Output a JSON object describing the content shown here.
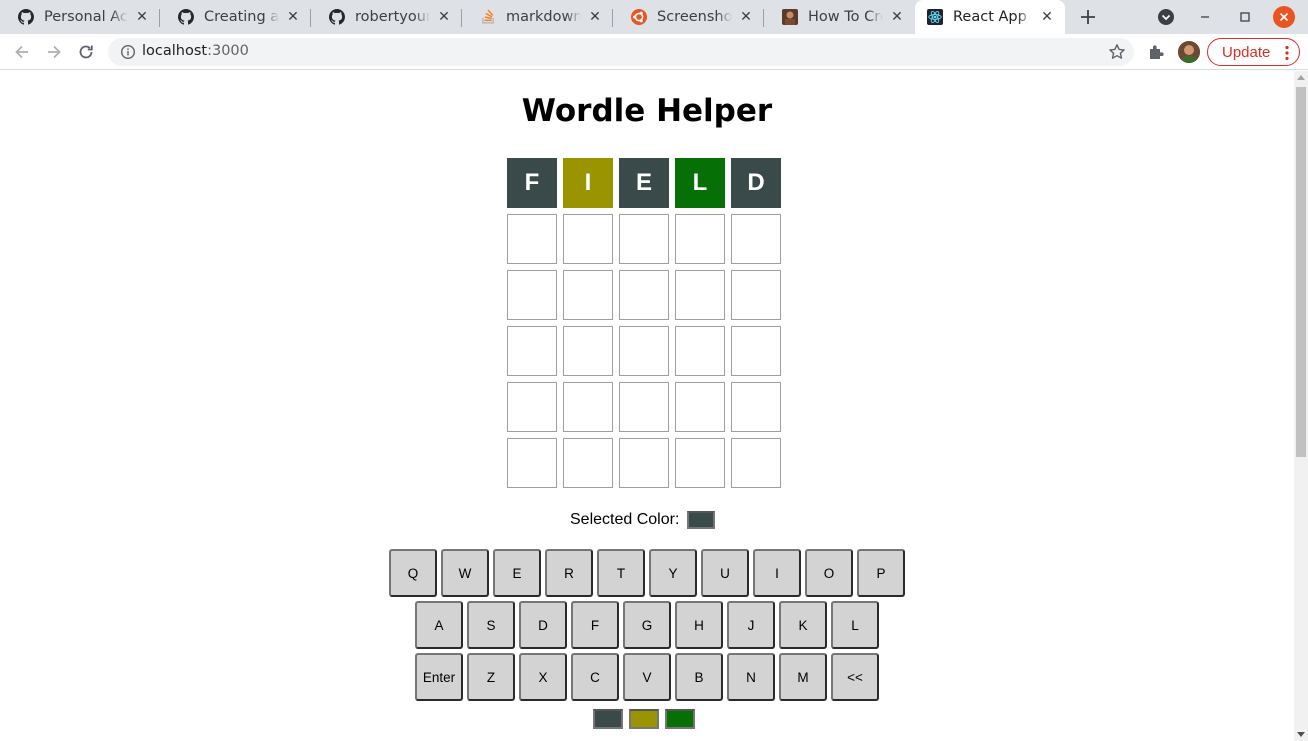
{
  "browser": {
    "tabs": [
      {
        "title": "Personal Access",
        "icon": "github-icon",
        "active": false
      },
      {
        "title": "Creating a person",
        "icon": "github-icon",
        "active": false
      },
      {
        "title": "robertyoung",
        "icon": "github-icon",
        "active": false
      },
      {
        "title": "markdown - How",
        "icon": "stackoverflow-icon",
        "active": false
      },
      {
        "title": "Screenshots",
        "icon": "ubuntu-icon",
        "active": false
      },
      {
        "title": "How To Create",
        "icon": "thumbnail-icon",
        "active": false
      },
      {
        "title": "React App",
        "icon": "react-icon",
        "active": true
      }
    ],
    "url_host": "localhost",
    "url_port": ":3000",
    "update_label": "Update",
    "colors": {
      "update": "#d93025",
      "close_window": "#e95420"
    }
  },
  "app": {
    "title": "Wordle Helper",
    "board": [
      [
        {
          "letter": "F",
          "color": "#3a4a4a"
        },
        {
          "letter": "I",
          "color": "#9a9400"
        },
        {
          "letter": "E",
          "color": "#3a4a4a"
        },
        {
          "letter": "L",
          "color": "#067006"
        },
        {
          "letter": "D",
          "color": "#3a4a4a"
        }
      ],
      [
        {
          "letter": ""
        },
        {
          "letter": ""
        },
        {
          "letter": ""
        },
        {
          "letter": ""
        },
        {
          "letter": ""
        }
      ],
      [
        {
          "letter": ""
        },
        {
          "letter": ""
        },
        {
          "letter": ""
        },
        {
          "letter": ""
        },
        {
          "letter": ""
        }
      ],
      [
        {
          "letter": ""
        },
        {
          "letter": ""
        },
        {
          "letter": ""
        },
        {
          "letter": ""
        },
        {
          "letter": ""
        }
      ],
      [
        {
          "letter": ""
        },
        {
          "letter": ""
        },
        {
          "letter": ""
        },
        {
          "letter": ""
        },
        {
          "letter": ""
        }
      ],
      [
        {
          "letter": ""
        },
        {
          "letter": ""
        },
        {
          "letter": ""
        },
        {
          "letter": ""
        },
        {
          "letter": ""
        }
      ]
    ],
    "selected_color_label": "Selected Color:",
    "selected_color": "#3a4a4a",
    "keyboard": [
      [
        "Q",
        "W",
        "E",
        "R",
        "T",
        "Y",
        "U",
        "I",
        "O",
        "P"
      ],
      [
        "A",
        "S",
        "D",
        "F",
        "G",
        "H",
        "J",
        "K",
        "L"
      ],
      [
        "Enter",
        "Z",
        "X",
        "C",
        "V",
        "B",
        "N",
        "M",
        "<<"
      ]
    ],
    "palette": [
      {
        "name": "gray",
        "color": "#3a4a4a"
      },
      {
        "name": "yellow",
        "color": "#9a9400"
      },
      {
        "name": "green",
        "color": "#067006"
      }
    ]
  }
}
